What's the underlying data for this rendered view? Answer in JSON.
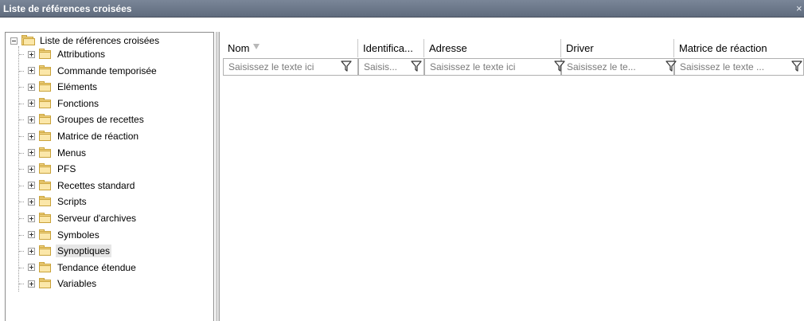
{
  "window": {
    "title": "Liste de références croisées",
    "close_glyph": "×"
  },
  "tree": {
    "root": {
      "label": "Liste de références croisées",
      "icon": "folder-open-icon"
    },
    "items": [
      {
        "label": "Attributions"
      },
      {
        "label": "Commande temporisée"
      },
      {
        "label": "Eléments"
      },
      {
        "label": "Fonctions"
      },
      {
        "label": "Groupes de recettes"
      },
      {
        "label": "Matrice de réaction"
      },
      {
        "label": "Menus"
      },
      {
        "label": "PFS"
      },
      {
        "label": "Recettes standard"
      },
      {
        "label": "Scripts"
      },
      {
        "label": "Serveur d'archives"
      },
      {
        "label": "Symboles"
      },
      {
        "label": "Synoptiques"
      },
      {
        "label": "Tendance étendue"
      },
      {
        "label": "Variables"
      }
    ],
    "selected_item": "Synoptiques"
  },
  "grid": {
    "columns": [
      {
        "header": "Nom",
        "filter_placeholder": "Saisissez le texte ici",
        "sorted": true
      },
      {
        "header": "Identifica...",
        "filter_placeholder": "Saisis..."
      },
      {
        "header": "Adresse",
        "filter_placeholder": "Saisissez le texte ici"
      },
      {
        "header": "Driver",
        "filter_placeholder": "Saisissez le te..."
      },
      {
        "header": "Matrice de réaction",
        "filter_placeholder": "Saisissez le texte ..."
      }
    ]
  },
  "colors": {
    "titlebar": "#6b7688",
    "folder": "#f6d98a",
    "selection": "#e6e6e6"
  }
}
